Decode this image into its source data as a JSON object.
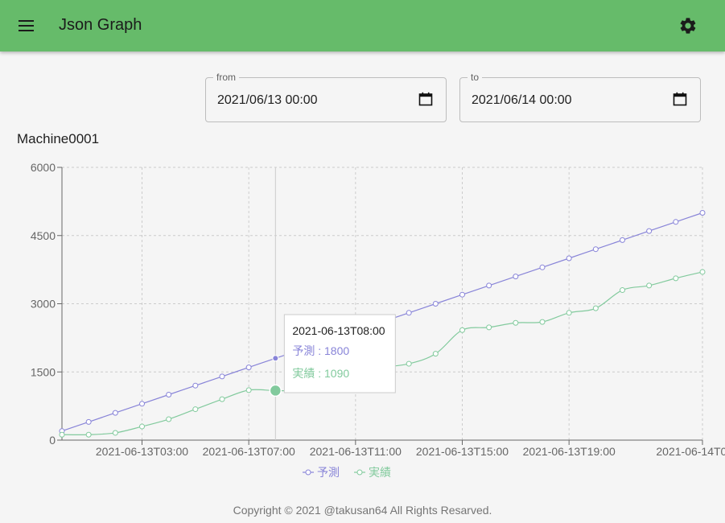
{
  "header": {
    "title": "Json Graph",
    "menu_icon": "menu-icon",
    "settings_icon": "gear-icon",
    "bar_color": "#66bb6a"
  },
  "filters": {
    "from": {
      "label": "from",
      "value": "2021/06/13 00:00"
    },
    "to": {
      "label": "to",
      "value": "2021/06/14 00:00"
    }
  },
  "chart_data": {
    "type": "line",
    "title": "Machine0001",
    "x": [
      "2021-06-13T00:00",
      "2021-06-13T01:00",
      "2021-06-13T02:00",
      "2021-06-13T03:00",
      "2021-06-13T04:00",
      "2021-06-13T05:00",
      "2021-06-13T06:00",
      "2021-06-13T07:00",
      "2021-06-13T08:00",
      "2021-06-13T09:00",
      "2021-06-13T10:00",
      "2021-06-13T11:00",
      "2021-06-13T12:00",
      "2021-06-13T13:00",
      "2021-06-13T14:00",
      "2021-06-13T15:00",
      "2021-06-13T16:00",
      "2021-06-13T17:00",
      "2021-06-13T18:00",
      "2021-06-13T19:00",
      "2021-06-13T20:00",
      "2021-06-13T21:00",
      "2021-06-13T22:00",
      "2021-06-13T23:00",
      "2021-06-14T00:00"
    ],
    "x_tick_labels": [
      "2021-06-13T03:00",
      "2021-06-13T07:00",
      "2021-06-13T11:00",
      "2021-06-13T15:00",
      "2021-06-13T19:00",
      "2021-06-14T00:00"
    ],
    "y_ticks": [
      0,
      1500,
      3000,
      4500,
      6000
    ],
    "ylim": [
      0,
      6000
    ],
    "grid": true,
    "legend_position": "bottom",
    "series": [
      {
        "name": "予測",
        "color": "#8884d8",
        "values": [
          200,
          400,
          600,
          800,
          1000,
          1200,
          1400,
          1600,
          1800,
          2000,
          2200,
          2400,
          2600,
          2800,
          3000,
          3200,
          3400,
          3600,
          3800,
          4000,
          4200,
          4400,
          4600,
          4800,
          5000
        ]
      },
      {
        "name": "実績",
        "color": "#82ca9d",
        "values": [
          120,
          120,
          160,
          300,
          460,
          680,
          900,
          1100,
          1090,
          1100,
          1300,
          1500,
          1600,
          1680,
          1900,
          2420,
          2480,
          2580,
          2600,
          2800,
          2900,
          3300,
          3400,
          3560,
          3700
        ]
      }
    ],
    "tooltip": {
      "x": "2021-06-13T08:00",
      "entries": [
        {
          "name": "予測",
          "value": 1800,
          "text": "予測 : 1800"
        },
        {
          "name": "実績",
          "value": 1090,
          "text": "実績 : 1090"
        }
      ]
    }
  },
  "footer": {
    "text": "Copyright © 2021 @takusan64 All Rights Resarved."
  }
}
